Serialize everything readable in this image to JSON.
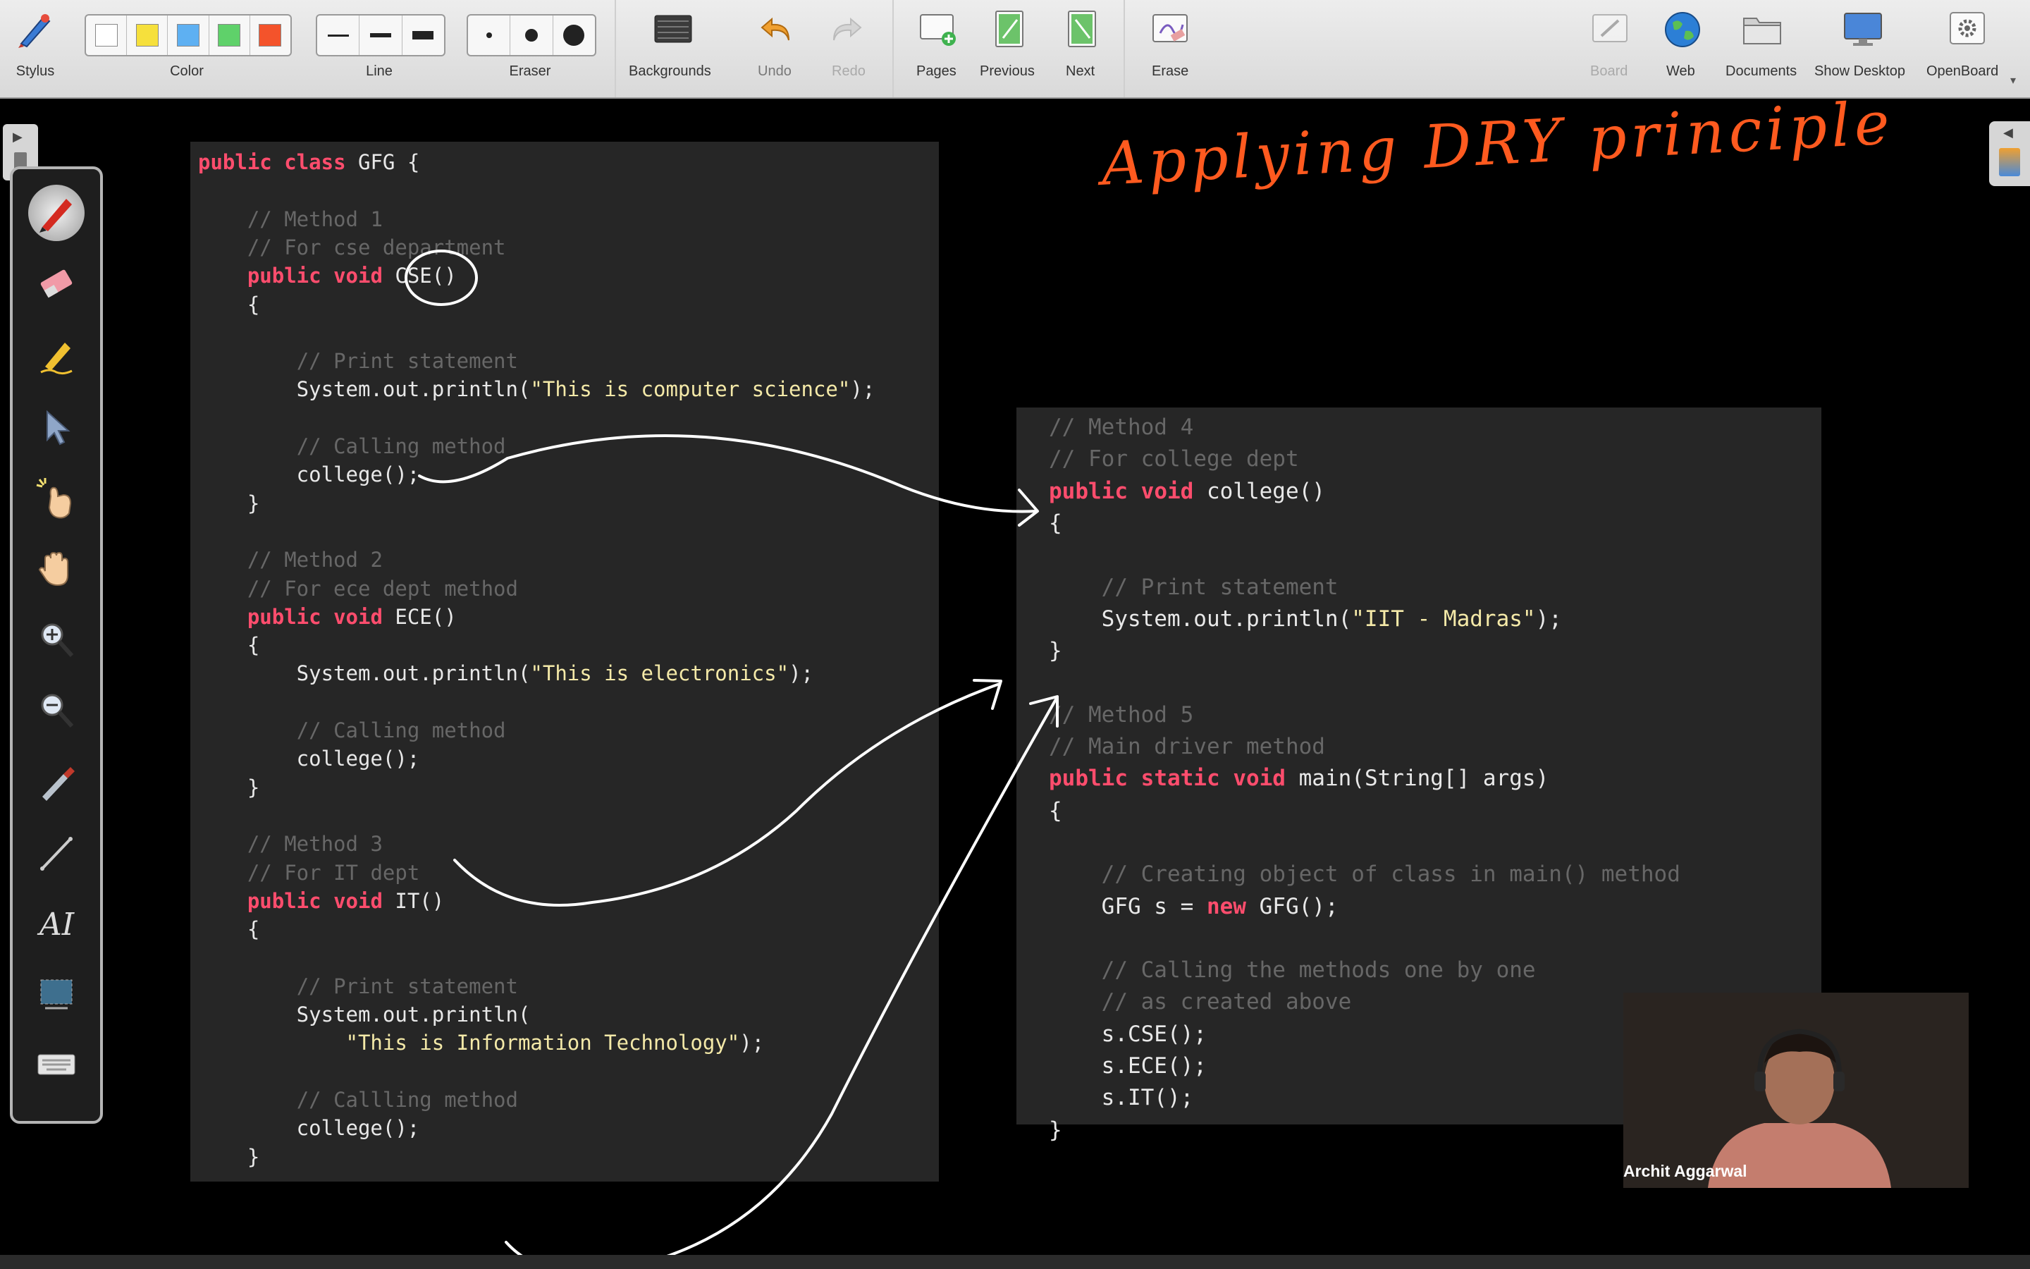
{
  "toolbar": {
    "stylus": "Stylus",
    "color": "Color",
    "line": "Line",
    "eraser": "Eraser",
    "backgrounds": "Backgrounds",
    "undo": "Undo",
    "redo": "Redo",
    "pages": "Pages",
    "previous": "Previous",
    "next": "Next",
    "erase": "Erase",
    "board": "Board",
    "web": "Web",
    "documents": "Documents",
    "show_desktop": "Show Desktop",
    "openboard": "OpenBoard",
    "colors": [
      "#ffffff",
      "#f6e03c",
      "#5eb0f2",
      "#5fd16a",
      "#f4532b"
    ]
  },
  "palette_icons": [
    "pen-icon",
    "eraser-icon",
    "highlighter-icon",
    "selector-icon",
    "laser-pointer-icon",
    "hand-icon",
    "zoom-in-icon",
    "zoom-out-icon",
    "capture-icon",
    "line-icon",
    "text-icon",
    "screenshot-icon",
    "keyboard-icon"
  ],
  "handwriting": {
    "title": "Applying DRY principle",
    "color": "#ff5a1f"
  },
  "left_code": [
    "public class GFG {",
    "",
    "    // Method 1",
    "    // For cse department",
    "    public void CSE()",
    "    {",
    "",
    "        // Print statement",
    "        System.out.println(\"This is computer science\");",
    "",
    "        // Calling method",
    "        college();",
    "    }",
    "",
    "    // Method 2",
    "    // For ece dept method",
    "    public void ECE()",
    "    {",
    "        System.out.println(\"This is electronics\");",
    "",
    "        // Calling method",
    "        college();",
    "    }",
    "",
    "    // Method 3",
    "    // For IT dept",
    "    public void IT()",
    "    {",
    "",
    "        // Print statement",
    "        System.out.println(",
    "            \"This is Information Technology\");",
    "",
    "        // Callling method",
    "        college();",
    "    }"
  ],
  "right_code": [
    "// Method 4",
    "// For college dept",
    "public void college()",
    "{",
    "",
    "    // Print statement",
    "    System.out.println(\"IIT - Madras\");",
    "}",
    "",
    "// Method 5",
    "// Main driver method",
    "public static void main(String[] args)",
    "{",
    "",
    "    // Creating object of class in main() method",
    "    GFG s = new GFG();",
    "",
    "    // Calling the methods one by one",
    "    // as created above",
    "    s.CSE();",
    "    s.ECE();",
    "    s.IT();",
    "}"
  ],
  "webcam": {
    "name": "Archit Aggarwal"
  }
}
